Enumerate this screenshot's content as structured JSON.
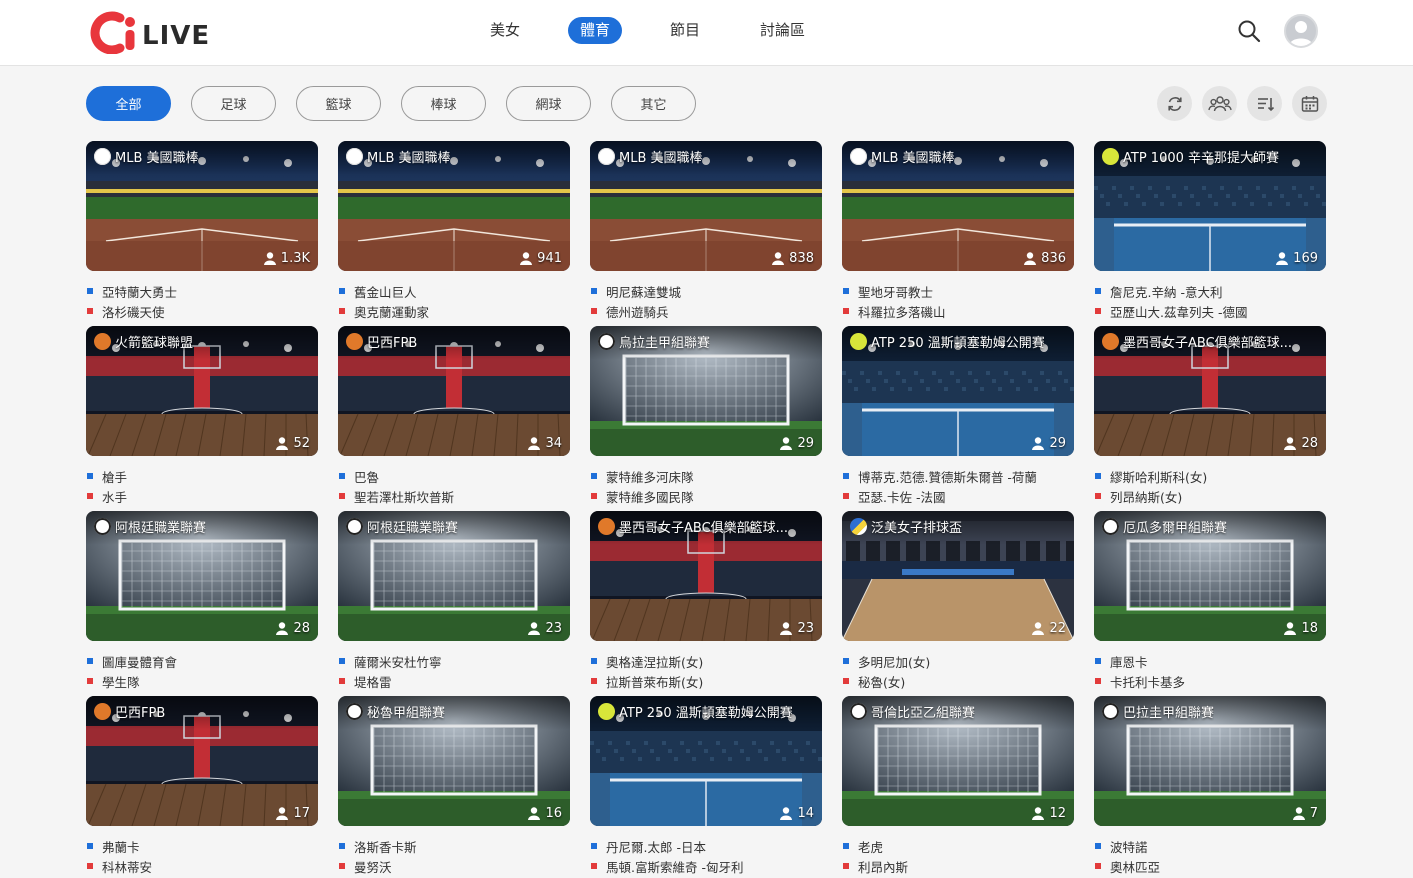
{
  "header": {
    "logo_text": "LIVE",
    "nav": [
      {
        "label": "美女",
        "active": false
      },
      {
        "label": "體育",
        "active": true
      },
      {
        "label": "節目",
        "active": false
      },
      {
        "label": "討論區",
        "active": false
      }
    ],
    "search_icon": "search-icon",
    "avatar_icon": "avatar-icon"
  },
  "filters": {
    "chips": [
      {
        "label": "全部",
        "active": true
      },
      {
        "label": "足球",
        "active": false
      },
      {
        "label": "籃球",
        "active": false
      },
      {
        "label": "棒球",
        "active": false
      },
      {
        "label": "網球",
        "active": false
      },
      {
        "label": "其它",
        "active": false
      }
    ],
    "tools": [
      "refresh-icon",
      "group-icon",
      "sort-icon",
      "calendar-icon"
    ]
  },
  "colors": {
    "accent": "#1e6fd9",
    "home_marker": "#1e6fd9",
    "away_marker": "#e23b3b",
    "logo_red": "#e8363c"
  },
  "cards": [
    {
      "sport": "baseball",
      "league": "MLB 美國職棒",
      "viewers": "1.3K",
      "home": "亞特蘭大勇士",
      "away": "洛杉磯天使"
    },
    {
      "sport": "baseball",
      "league": "MLB 美國職棒",
      "viewers": "941",
      "home": "舊金山巨人",
      "away": "奧克蘭運動家"
    },
    {
      "sport": "baseball",
      "league": "MLB 美國職棒",
      "viewers": "838",
      "home": "明尼蘇達雙城",
      "away": "德州遊騎兵"
    },
    {
      "sport": "baseball",
      "league": "MLB 美國職棒",
      "viewers": "836",
      "home": "聖地牙哥教士",
      "away": "科羅拉多落磯山"
    },
    {
      "sport": "tennis",
      "league": "ATP 1000 辛辛那提大師賽",
      "viewers": "169",
      "home": "詹尼克.辛納 -意大利",
      "away": "亞歷山大.茲韋列夫 -德國"
    },
    {
      "sport": "basketball",
      "league": "火箭籃球聯盟",
      "viewers": "52",
      "home": "槍手",
      "away": "水手"
    },
    {
      "sport": "basketball",
      "league": "巴西FPB",
      "viewers": "34",
      "home": "巴魯",
      "away": "聖若澤杜斯坎普斯"
    },
    {
      "sport": "football",
      "league": "烏拉圭甲組聯賽",
      "viewers": "29",
      "home": "蒙特維多河床隊",
      "away": "蒙特維多國民隊"
    },
    {
      "sport": "tennis",
      "league": "ATP 250 溫斯頓塞勒姆公開賽",
      "viewers": "29",
      "home": "博蒂克.范德.贊德斯朱爾普 -荷蘭",
      "away": "亞瑟.卡佐 -法國"
    },
    {
      "sport": "basketball",
      "league": "墨西哥女子ABC俱樂部籃球...",
      "viewers": "28",
      "home": "繆斯哈利斯科(女)",
      "away": "列昂納斯(女)"
    },
    {
      "sport": "football",
      "league": "阿根廷職業聯賽",
      "viewers": "28",
      "home": "圖庫曼體育會",
      "away": "學生隊"
    },
    {
      "sport": "football",
      "league": "阿根廷職業聯賽",
      "viewers": "23",
      "home": "薩爾米安杜竹寧",
      "away": "堤格雷"
    },
    {
      "sport": "basketball",
      "league": "墨西哥女子ABC俱樂部籃球...",
      "viewers": "23",
      "home": "奧格達涅拉斯(女)",
      "away": "拉斯普萊布斯(女)"
    },
    {
      "sport": "volleyball",
      "league": "泛美女子排球盃",
      "viewers": "22",
      "home": "多明尼加(女)",
      "away": "秘魯(女)"
    },
    {
      "sport": "football",
      "league": "厄瓜多爾甲組聯賽",
      "viewers": "18",
      "home": "庫恩卡",
      "away": "卡托利卡基多"
    },
    {
      "sport": "basketball",
      "league": "巴西FPB",
      "viewers": "17",
      "home": "弗蘭卡",
      "away": "科林蒂安"
    },
    {
      "sport": "football",
      "league": "秘魯甲組聯賽",
      "viewers": "16",
      "home": "洛斯香卡斯",
      "away": "曼努沃"
    },
    {
      "sport": "tennis",
      "league": "ATP 250 溫斯頓塞勒姆公開賽",
      "viewers": "14",
      "home": "丹尼爾.太郎 -日本",
      "away": "馬頓.富斯索維奇 -匈牙利"
    },
    {
      "sport": "football",
      "league": "哥倫比亞乙組聯賽",
      "viewers": "12",
      "home": "老虎",
      "away": "利昂內斯"
    },
    {
      "sport": "football",
      "league": "巴拉圭甲組聯賽",
      "viewers": "7",
      "home": "波特諾",
      "away": "奧林匹亞"
    }
  ]
}
